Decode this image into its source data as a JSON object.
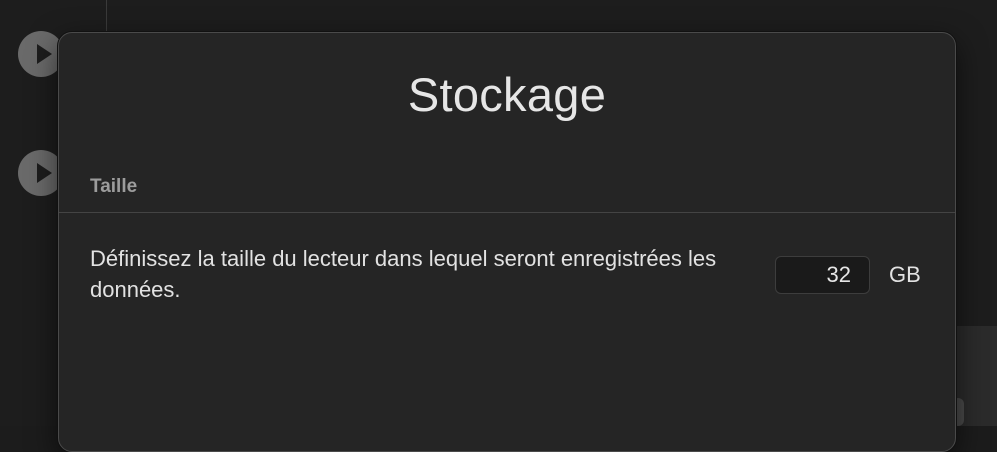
{
  "dialog": {
    "title": "Stockage",
    "section_header": "Taille",
    "description": "Définissez la taille du lecteur dans lequel seront enregistrées les données.",
    "size_value": "32",
    "size_unit": "GB"
  },
  "colors": {
    "background": "#1d1d1d",
    "dialog": "#252525",
    "text": "#e2e2e2",
    "muted_text": "#9c9c9c"
  },
  "icons": [
    "play-icon",
    "play-icon"
  ]
}
